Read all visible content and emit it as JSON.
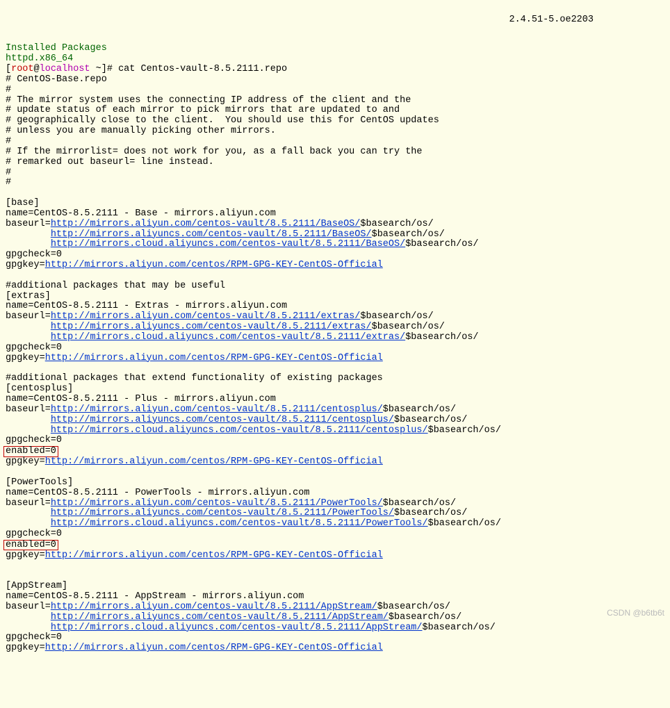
{
  "header": {
    "installed": "Installed Packages",
    "package": "httpd.x86_64",
    "version": "2.4.51-5.oe2203"
  },
  "prompt": {
    "open": "[",
    "user": "root",
    "at": "@",
    "host": "localhost",
    "path": " ~]# ",
    "cmd": "cat Centos-vault-8.5.2111.repo"
  },
  "intro": {
    "l0": "# CentOS-Base.repo",
    "l1": "#",
    "l2": "# The mirror system uses the connecting IP address of the client and the",
    "l3": "# update status of each mirror to pick mirrors that are updated to and",
    "l4": "# geographically close to the client.  You should use this for CentOS updates",
    "l5": "# unless you are manually picking other mirrors.",
    "l6": "#",
    "l7": "# If the mirrorlist= does not work for you, as a fall back you can try the",
    "l8": "# remarked out baseurl= line instead.",
    "l9": "#",
    "l10": "#"
  },
  "base": {
    "section": "[base]",
    "name": "name=CentOS-8.5.2111 - Base - mirrors.aliyun.com",
    "bpfx": "baseurl=",
    "u1": "http://mirrors.aliyun.com/centos-vault/8.5.2111/BaseOS/",
    "u2": "http://mirrors.aliyuncs.com/centos-vault/8.5.2111/BaseOS/",
    "u3": "http://mirrors.cloud.aliyuncs.com/centos-vault/8.5.2111/BaseOS/",
    "suf": "$basearch/os/",
    "gpg": "gpgcheck=0",
    "kpfx": "gpgkey=",
    "key": "http://mirrors.aliyun.com/centos/RPM-GPG-KEY-CentOS-Official"
  },
  "extras": {
    "comment": "#additional packages that may be useful",
    "section": "[extras]",
    "name": "name=CentOS-8.5.2111 - Extras - mirrors.aliyun.com",
    "bpfx": "baseurl=",
    "u1": "http://mirrors.aliyun.com/centos-vault/8.5.2111/extras/",
    "u2": "http://mirrors.aliyuncs.com/centos-vault/8.5.2111/extras/",
    "u3": "http://mirrors.cloud.aliyuncs.com/centos-vault/8.5.2111/extras/",
    "suf": "$basearch/os/",
    "gpg": "gpgcheck=0",
    "kpfx": "gpgkey=",
    "key": "http://mirrors.aliyun.com/centos/RPM-GPG-KEY-CentOS-Official"
  },
  "plus": {
    "comment": "#additional packages that extend functionality of existing packages",
    "section": "[centosplus]",
    "name": "name=CentOS-8.5.2111 - Plus - mirrors.aliyun.com",
    "bpfx": "baseurl=",
    "u1": "http://mirrors.aliyun.com/centos-vault/8.5.2111/centosplus/",
    "u2": "http://mirrors.aliyuncs.com/centos-vault/8.5.2111/centosplus/",
    "u3": "http://mirrors.cloud.aliyuncs.com/centos-vault/8.5.2111/centosplus/",
    "suf": "$basearch/os/",
    "gpg": "gpgcheck=0",
    "enabled": "enabled=0",
    "kpfx": "gpgkey=",
    "key": "http://mirrors.aliyun.com/centos/RPM-GPG-KEY-CentOS-Official"
  },
  "pt": {
    "section": "[PowerTools]",
    "name": "name=CentOS-8.5.2111 - PowerTools - mirrors.aliyun.com",
    "bpfx": "baseurl=",
    "u1": "http://mirrors.aliyun.com/centos-vault/8.5.2111/PowerTools/",
    "u2": "http://mirrors.aliyuncs.com/centos-vault/8.5.2111/PowerTools/",
    "u3": "http://mirrors.cloud.aliyuncs.com/centos-vault/8.5.2111/PowerTools/",
    "suf": "$basearch/os/",
    "gpg": "gpgcheck=0",
    "enabled": "enabled=0",
    "kpfx": "gpgkey=",
    "key": "http://mirrors.aliyun.com/centos/RPM-GPG-KEY-CentOS-Official"
  },
  "app": {
    "section": "[AppStream]",
    "name": "name=CentOS-8.5.2111 - AppStream - mirrors.aliyun.com",
    "bpfx": "baseurl=",
    "u1": "http://mirrors.aliyun.com/centos-vault/8.5.2111/AppStream/",
    "u2": "http://mirrors.aliyuncs.com/centos-vault/8.5.2111/AppStream/",
    "u3": "http://mirrors.cloud.aliyuncs.com/centos-vault/8.5.2111/AppStream/",
    "suf": "$basearch/os/",
    "gpg": "gpgcheck=0",
    "kpfx": "gpgkey=",
    "key": "http://mirrors.aliyun.com/centos/RPM-GPG-KEY-CentOS-Official"
  },
  "watermark": "CSDN @b6tb6t",
  "indent": "        "
}
